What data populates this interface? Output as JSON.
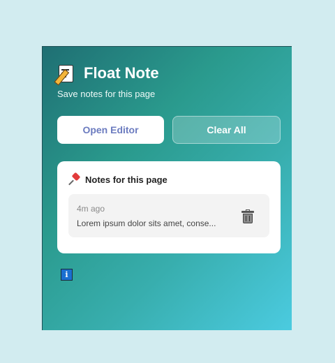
{
  "app": {
    "title": "Float Note",
    "subtitle": "Save notes for this page",
    "logo_icon": "memo-icon"
  },
  "actions": {
    "open_editor_label": "Open Editor",
    "clear_all_label": "Clear All"
  },
  "notes_card": {
    "title": "Notes for this page",
    "title_icon": "pushpin-icon",
    "notes": [
      {
        "time": "4m ago",
        "text": "Lorem ipsum dolor sits amet, conse...",
        "delete_icon": "trash-icon"
      }
    ]
  },
  "footer": {
    "info_label": "i",
    "info_icon": "info-icon"
  },
  "colors": {
    "page_background": "#d2ecf0",
    "gradient_start": "#1f6f73",
    "gradient_end": "#4bcbe0",
    "open_editor_text": "#6b7bbf",
    "info_blue": "#1a6fd0"
  }
}
